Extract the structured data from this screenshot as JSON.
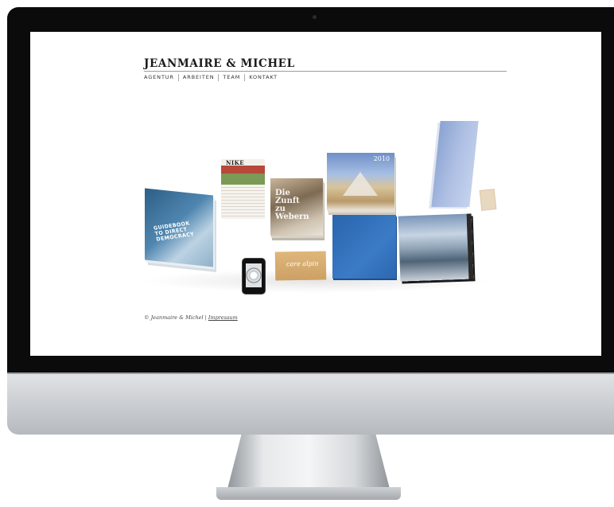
{
  "site": {
    "brand": "JEANMAIRE & MICHEL",
    "nav": [
      "AGENTUR",
      "ARBEITEN",
      "TEAM",
      "KONTAKT"
    ],
    "footer": {
      "copyright": "© Jeanmaire & Michel",
      "separator": " | ",
      "impressum": "Impressum"
    }
  },
  "showcase": {
    "guidebook_title": "GUIDEBOOK\nTO DIRECT\nDEMOCRACY",
    "nike_label": "NIKE",
    "zunft_title": "Die\nZunft\nzu\nWebern",
    "pyramid_year": "2010",
    "care_logo": "care alpin"
  },
  "colors": {
    "brand_text": "#1a1a1a",
    "bezel": "#0b0b0b",
    "screen_bg": "#ffffff"
  }
}
